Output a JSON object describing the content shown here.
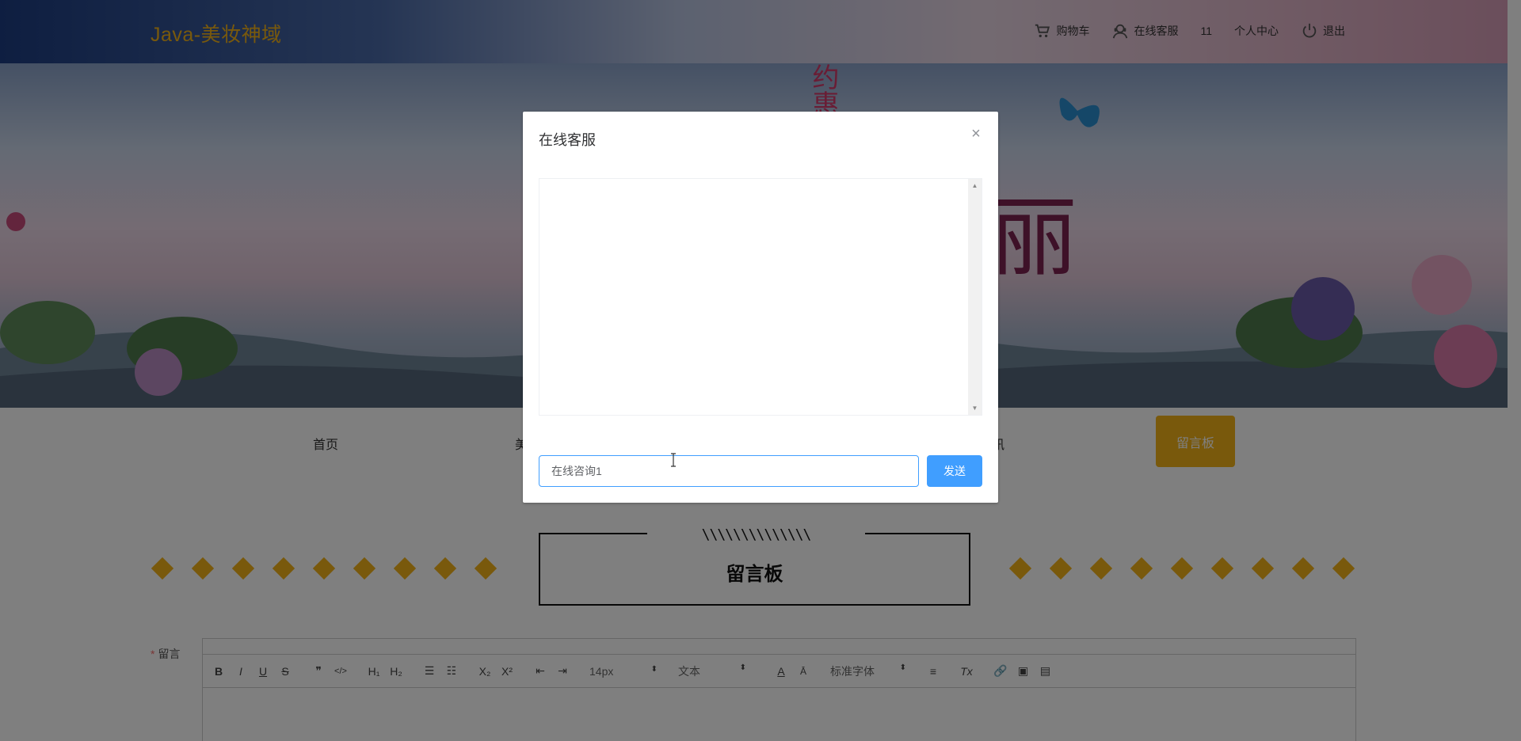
{
  "header": {
    "logo": "Java-美妆神域",
    "nav": {
      "cart": "购物车",
      "service": "在线客服",
      "user": "11",
      "profile": "个人中心",
      "logout": "退出"
    }
  },
  "banner": {
    "slogan": "丽",
    "vertical_text": "约惠"
  },
  "main_nav": {
    "home": "首页",
    "item2_partial": "美",
    "item_partial": "讯",
    "active": "留言板"
  },
  "section": {
    "hatch": "\\\\\\\\\\\\\\\\\\\\\\\\\\\\",
    "title": "留言板"
  },
  "form": {
    "required_mark": "*",
    "label": "留言"
  },
  "editor_toolbar": {
    "bold": "B",
    "italic": "I",
    "underline": "U",
    "strike": "S",
    "quote": "❞",
    "code": "</>",
    "h1": "H₁",
    "h2": "H₂",
    "ordered": "☰",
    "bullet": "☷",
    "sub": "X₂",
    "sup": "X²",
    "outdent": "⇤",
    "indent": "⇥",
    "size": "14px",
    "format": "文本",
    "font": "标准字体",
    "align": "≡",
    "clear": "Tx",
    "link": "🔗",
    "image": "▣",
    "video": "▤",
    "arrow": "⬍"
  },
  "dialog": {
    "title": "在线客服",
    "close": "×",
    "input_value": "在线咨询1",
    "send": "发送",
    "scroll_up": "▲",
    "scroll_down": "▼"
  },
  "colors": {
    "accent": "#f2b319",
    "primary": "#409eff"
  }
}
